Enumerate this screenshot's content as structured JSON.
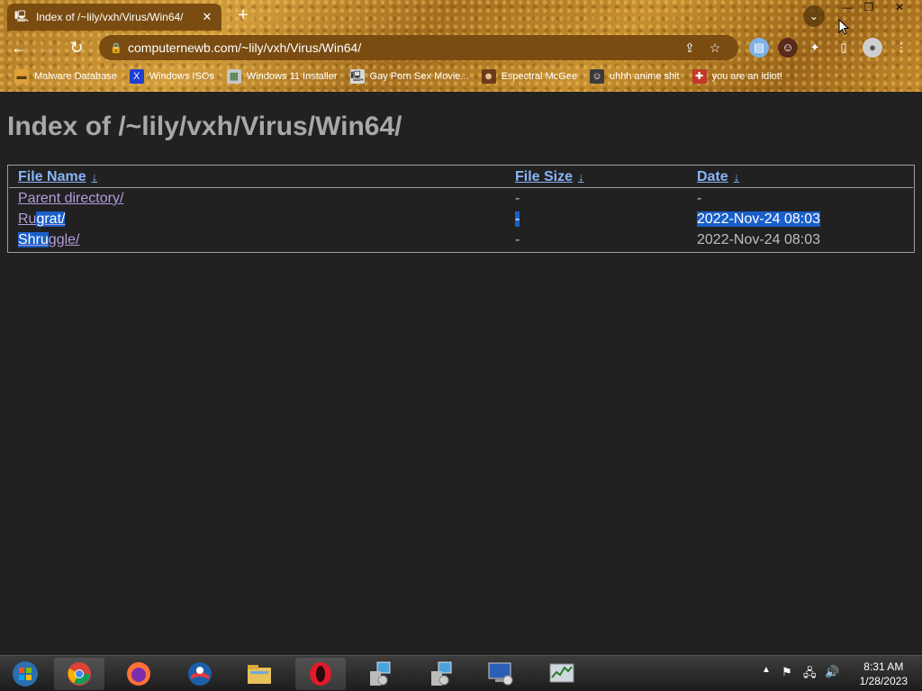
{
  "browser": {
    "tab": {
      "title": "Index of /~lily/vxh/Virus/Win64/",
      "favicon": "computer-favicon-icon"
    },
    "address": {
      "url": "computernewb.com/~lily/vxh/Virus/Win64/"
    },
    "bookmarks": [
      {
        "label": "Malware Database",
        "icon": "folder-icon",
        "color": "#e0a13a"
      },
      {
        "label": "Windows ISOs",
        "icon": "x-logo-icon",
        "color": "#1f3fd1"
      },
      {
        "label": "Windows 11 Installer",
        "icon": "image-icon",
        "color": "#c8c8c8"
      },
      {
        "label": "Gay Porn Sex Movie...",
        "icon": "computer-icon",
        "color": "#d8d8d8"
      },
      {
        "label": "Espectral McGee",
        "icon": "face-icon",
        "color": "#6b3b1a"
      },
      {
        "label": "uhhh anime shit",
        "icon": "anime-face-icon",
        "color": "#3a3a3a"
      },
      {
        "label": "you are an idiot!",
        "icon": "flag-icon",
        "color": "#c0392b"
      }
    ]
  },
  "page": {
    "heading": "Index of /~lily/vxh/Virus/Win64/",
    "columns": {
      "name": "File Name",
      "size": "File Size",
      "date": "Date",
      "sort_arrow": "↓"
    },
    "rows": [
      {
        "name": "Parent directory/",
        "size": "-",
        "date": "-"
      },
      {
        "name_part1": "Ru",
        "name_part2": "grat/",
        "size": "-",
        "date": "2022-Nov-24 08:03"
      },
      {
        "name_part1": "Shru",
        "name_part2": "ggle/",
        "size": "-",
        "date": "2022-Nov-24 08:03"
      }
    ]
  },
  "taskbar": {
    "apps": [
      "start-orb-icon",
      "chrome-icon",
      "firefox-icon",
      "obama-icon",
      "file-explorer-icon",
      "opera-icon",
      "network-installer-icon",
      "network-installer-2-icon",
      "remote-desktop-icon",
      "performance-monitor-icon"
    ],
    "time": "8:31 AM",
    "date": "1/28/2023"
  }
}
